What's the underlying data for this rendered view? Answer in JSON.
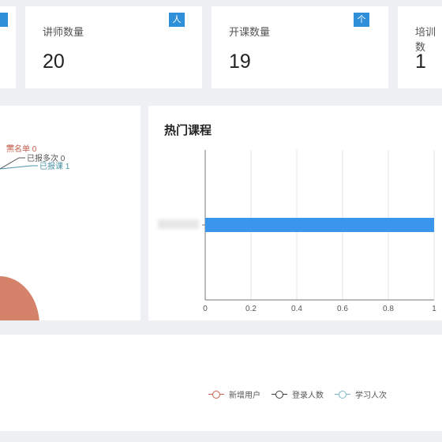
{
  "stats": [
    {
      "title": "",
      "value": "",
      "badge": ""
    },
    {
      "title": "讲师数量",
      "value": "20",
      "badge": "人"
    },
    {
      "title": "开课数量",
      "value": "19",
      "badge": "个"
    },
    {
      "title": "培训数",
      "value": "1",
      "badge": ""
    }
  ],
  "pie": {
    "labels": [
      "黑名单 0",
      "已报多次 0",
      "已报课 1"
    ],
    "colors": {
      "slice": "#d4826a",
      "label1": "#c25e4a",
      "label2": "#555555",
      "label3": "#4a95a8"
    }
  },
  "hot_courses": {
    "title": "热门课程",
    "bar_label": "1",
    "category_label": "blurred"
  },
  "chart_data": {
    "type": "bar",
    "orientation": "horizontal",
    "title": "热门课程",
    "categories": [
      "(blurred)"
    ],
    "values": [
      1
    ],
    "xlim": [
      0,
      1
    ],
    "x_ticks": [
      "0",
      "0.2",
      "0.4",
      "0.6",
      "0.8",
      "1"
    ],
    "grid": true,
    "bar_color": "#3a96ec"
  },
  "legend": [
    {
      "label": "新增用户",
      "color": "#c95f4a"
    },
    {
      "label": "登录人数",
      "color": "#3a3a3a"
    },
    {
      "label": "学习人次",
      "color": "#7ab6c4"
    }
  ]
}
